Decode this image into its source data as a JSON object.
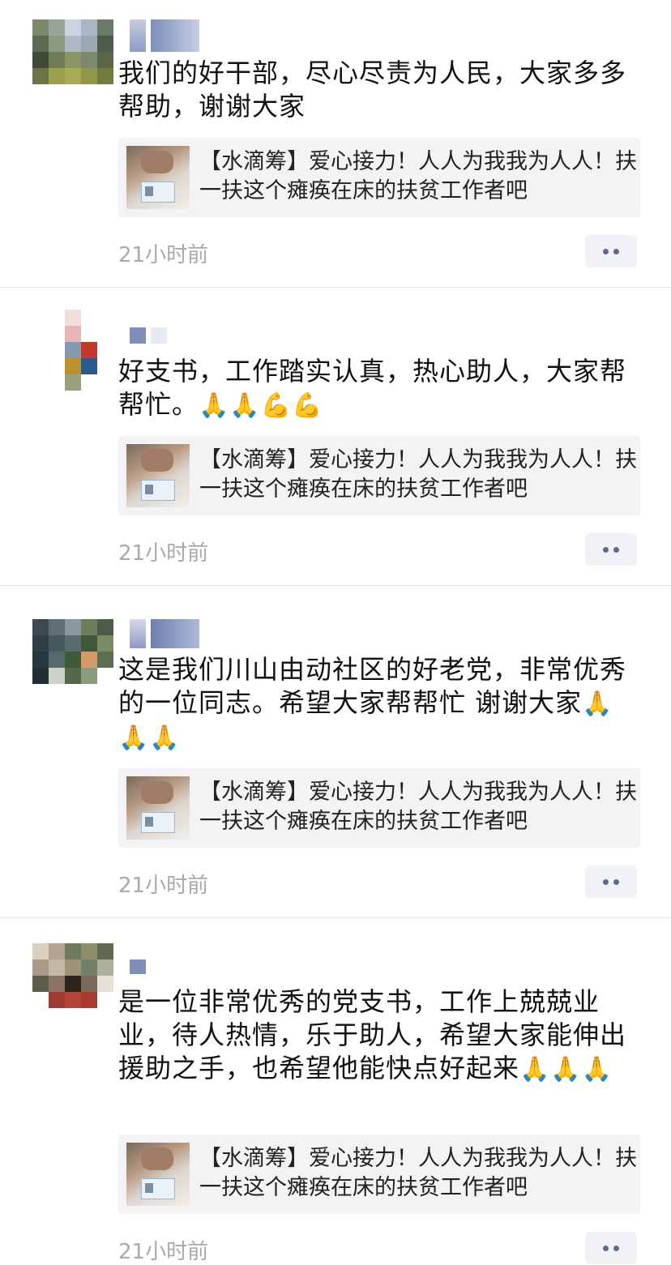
{
  "posts": [
    {
      "text": "我们的好干部，尽心尽责为人民，大家多多帮助，谢谢大家",
      "emoji": "",
      "link_title": "【水滴筹】爱心接力！人人为我我为人人！扶一扶这个瘫痪在床的扶贫工作者吧",
      "time": "21小时前"
    },
    {
      "text": "好支书，工作踏实认真，热心助人，大家帮帮忙。",
      "emoji": "🙏🙏💪💪",
      "link_title": "【水滴筹】爱心接力！人人为我我为人人！扶一扶这个瘫痪在床的扶贫工作者吧",
      "time": "21小时前"
    },
    {
      "text": "这是我们川山由动社区的好老党，非常优秀的一位同志。希望大家帮帮忙 谢谢大家",
      "emoji": "🙏🙏🙏",
      "link_title": "【水滴筹】爱心接力！人人为我我为人人！扶一扶这个瘫痪在床的扶贫工作者吧",
      "time": "21小时前"
    },
    {
      "text": "是一位非常优秀的党支书，工作上兢兢业业，待人热情，乐于助人，希望大家能伸出援助之手，也希望他能快点好起来",
      "emoji": "🙏🙏🙏",
      "link_title": "【水滴筹】爱心接力！人人为我我为人人！扶一扶这个瘫痪在床的扶贫工作者吧",
      "time": "21小时前"
    }
  ],
  "colors": {
    "text": "#111111",
    "time": "#a9a9a9",
    "card_bg": "#f3f3f5",
    "dots": "#5b6c92"
  }
}
